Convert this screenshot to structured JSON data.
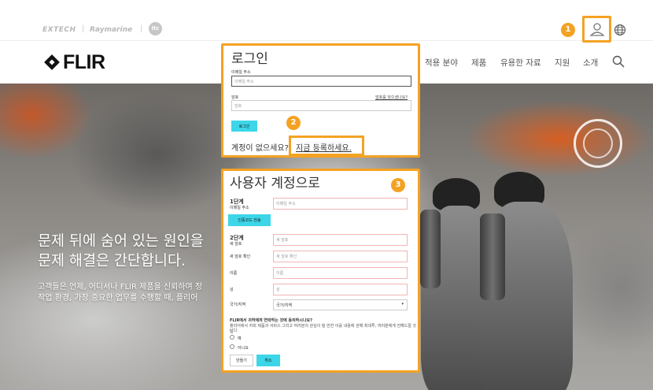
{
  "topbar": {
    "brands": [
      "EXTECH",
      "Raymarine",
      "itc"
    ],
    "separator": "|"
  },
  "nav": {
    "logo_text": "FLIR",
    "items": [
      "적용 분야",
      "제품",
      "유용한 자료",
      "지원",
      "소개"
    ]
  },
  "hero": {
    "title_line1": "문제 뒤에 숨어 있는 원인을",
    "title_line2": "문제 해결은 간단합니다.",
    "desc_line1": "고객들은 언제, 어디서나 FLIR 제품을 신뢰하며 정",
    "desc_line2": "작업 환경, 가장 중요한 업무를 수행할 때, 플리어"
  },
  "login": {
    "title": "로그인",
    "email_label": "이메일 주소",
    "email_placeholder": "이메일 주소",
    "password_label": "암호",
    "password_placeholder": "암호",
    "forgot_link": "암호를 잊으셨나요?",
    "login_button": "로그인",
    "no_account_text": "계정이 없으세요?",
    "register_link": "지금 등록하세요."
  },
  "register": {
    "title": "사용자 계정으로",
    "step1_label": "1단계",
    "step1_field_label": "이메일 주소",
    "step1_placeholder": "이메일 주소",
    "send_code_button": "인증코드 전송",
    "step2_label": "2단계",
    "new_password_label": "새 암호",
    "new_password_placeholder": "새 암호",
    "confirm_password_label": "새 암호 확인",
    "confirm_password_placeholder": "새 암호 확인",
    "first_name_label": "이름",
    "first_name_placeholder": "이름",
    "last_name_label": "성",
    "last_name_placeholder": "성",
    "country_label": "국가/지역",
    "country_value": "국가/지역",
    "marketing_question": "FLIR에서 귀하에게 연락하는 것에 동의하시나요?",
    "marketing_desc_line1": "플리어에서 자회 제품과 서비스 그리고 여러분의 관심이 될 만한 이를 내용에 관해 최대투, 여러분에게 전해드릴 것입",
    "marketing_desc_line2": "니다.",
    "radio_yes": "예",
    "radio_no": "아니요",
    "create_button": "만들기",
    "cancel_button": "취소"
  },
  "badges": [
    "1",
    "2",
    "3"
  ],
  "colors": {
    "highlight": "#f4a223",
    "button": "#3cd6e8"
  }
}
